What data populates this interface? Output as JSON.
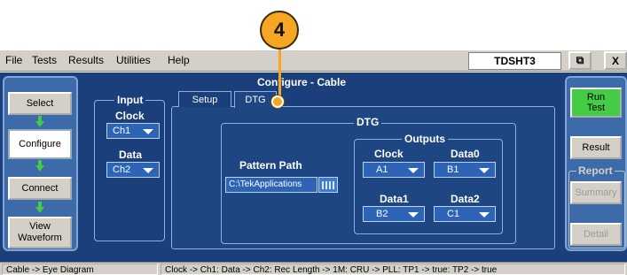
{
  "callout": {
    "number": "4"
  },
  "menu": {
    "items": [
      "File",
      "Tests",
      "Results",
      "Utilities",
      "Help"
    ]
  },
  "app_title": "TDSHT3",
  "window_buttons": {
    "restore": "⧉",
    "close": "X"
  },
  "page_title": "Configure - Cable",
  "left_nav": {
    "select": "Select",
    "configure": "Configure",
    "connect": "Connect",
    "view_waveform": "View\nWaveform"
  },
  "input": {
    "group_label": "Input",
    "clock_label": "Clock",
    "clock_value": "Ch1",
    "data_label": "Data",
    "data_value": "Ch2"
  },
  "tabs": {
    "setup": "Setup",
    "dtg": "DTG"
  },
  "dtg": {
    "group_label": "DTG",
    "pattern_path_label": "Pattern Path",
    "pattern_path_value": "C:\\TekApplications",
    "outputs_label": "Outputs",
    "clock_label": "Clock",
    "clock_value": "A1",
    "data0_label": "Data0",
    "data0_value": "B1",
    "data1_label": "Data1",
    "data1_value": "B2",
    "data2_label": "Data2",
    "data2_value": "C1"
  },
  "right": {
    "run_test": "Run\nTest",
    "result": "Result",
    "report_label": "Report",
    "summary": "Summary",
    "detail": "Detail"
  },
  "status": {
    "left": "Cable -> Eye Diagram",
    "right": "Clock -> Ch1: Data -> Ch2: Rec Length -> 1M: CRU -> PLL: TP1 -> true: TP2 -> true"
  },
  "colors": {
    "accent": "#f5a623",
    "run": "#44cc44",
    "panel": "#1a3f7a"
  }
}
